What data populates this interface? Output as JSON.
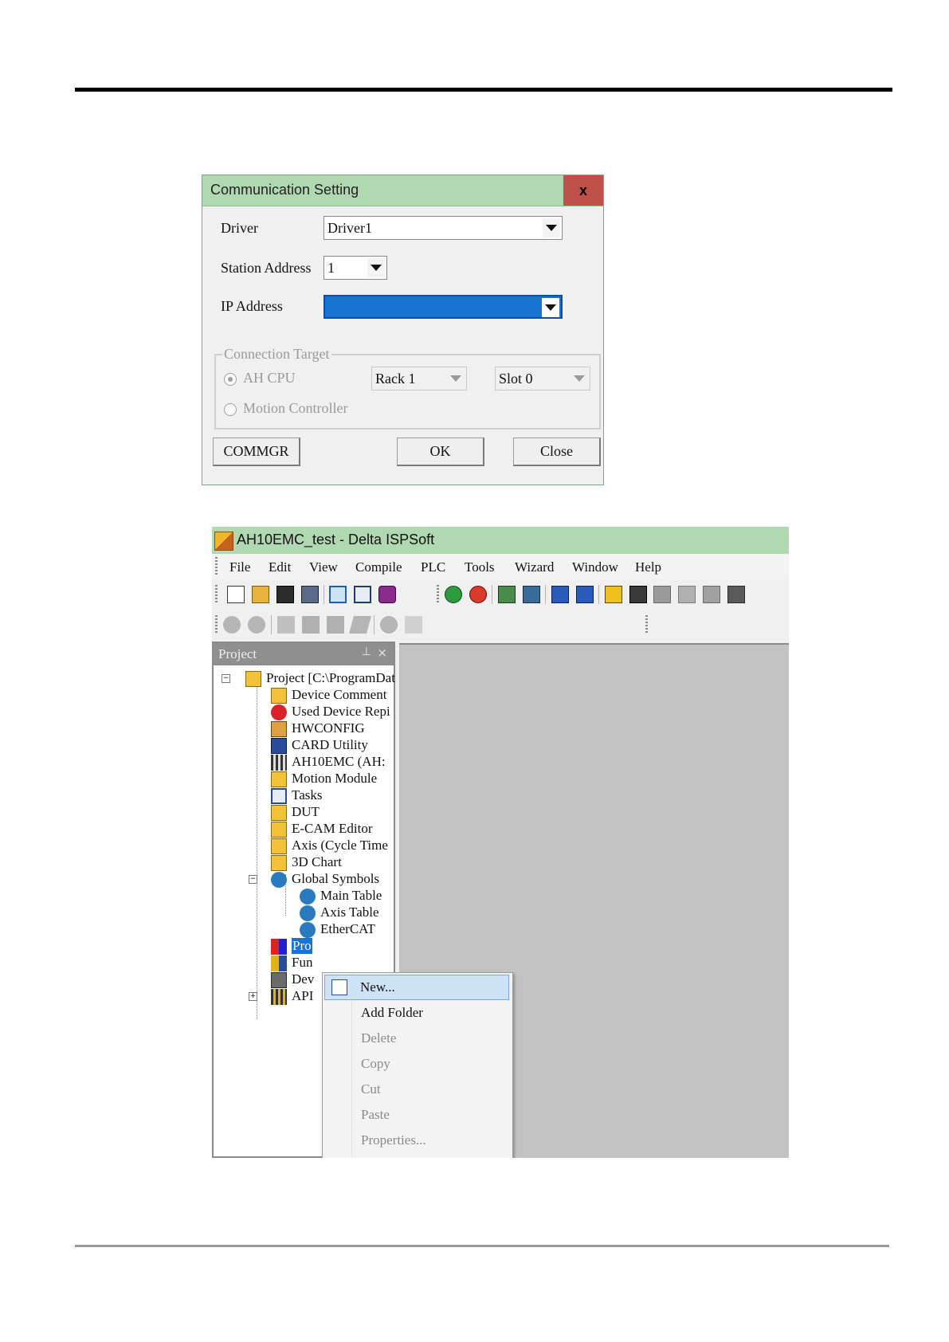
{
  "dialog": {
    "title": "Communication Setting",
    "close": "x",
    "driver_label": "Driver",
    "driver_value": "Driver1",
    "station_label": "Station Address",
    "station_value": "1",
    "ip_label": "IP Address",
    "ip_value": "",
    "group_title": "Connection Target",
    "radio_ahcpu": "AH CPU",
    "radio_motion": "Motion Controller",
    "rack_value": "Rack 1",
    "slot_value": "Slot 0",
    "btn_commgr": "COMMGR",
    "btn_ok": "OK",
    "btn_close": "Close"
  },
  "window": {
    "title": "AH10EMC_test - Delta ISPSoft",
    "menu": [
      "File",
      "Edit",
      "View",
      "Compile",
      "PLC",
      "Tools",
      "Wizard",
      "Window",
      "Help"
    ],
    "panel_title": "Project",
    "panel_pin": "⊥",
    "panel_close": "×",
    "tree": [
      "Project [C:\\ProgramDat",
      "Device Comment",
      "Used Device Repi",
      "HWCONFIG",
      "CARD Utility",
      "AH10EMC  (AH:",
      "Motion Module",
      "Tasks",
      "DUT",
      "E-CAM Editor",
      "Axis (Cycle Time",
      "3D Chart",
      "Global Symbols",
      "Main Table",
      "Axis Table",
      "EtherCAT",
      "Pro",
      "Fun",
      "Dev",
      "API"
    ],
    "context_menu": [
      "New...",
      "Add Folder",
      "Delete",
      "Copy",
      "Cut",
      "Paste",
      "Properties..."
    ]
  },
  "colors": {
    "title_bar": "#b1d9b1",
    "close_button": "#c0504a",
    "selection": "#1874d2",
    "work_area": "#c2c2c2"
  }
}
